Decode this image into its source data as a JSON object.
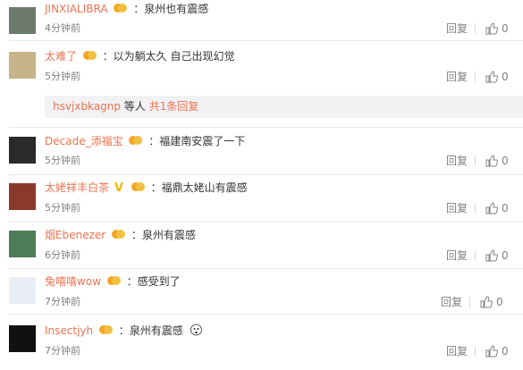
{
  "comments": [
    {
      "user": "JINXIALIBRA",
      "text": "：泉州也有震感",
      "time": "4分钟前",
      "reply": "回复",
      "likes": "0",
      "avatar_color": "#6b7a6a"
    },
    {
      "user": "太难了",
      "text": "：以为躺太久 自己出现幻觉",
      "time": "5分钟前",
      "reply": "回复",
      "likes": "0",
      "avatar_color": "#c8b48a",
      "subreply": {
        "user": "hsvjxbkagnp",
        "mid": " 等人 ",
        "link": "共1条回复"
      }
    },
    {
      "user": "Decade_添福宝",
      "text": "：福建南安震了一下",
      "time": "5分钟前",
      "reply": "回复",
      "likes": "0",
      "avatar_color": "#2a2a2a"
    },
    {
      "user": "太姥祥丰白茶",
      "badge": "V",
      "text": "：福鼎太姥山有震感",
      "time": "5分钟前",
      "reply": "回复",
      "likes": "0",
      "avatar_color": "#8a3a2a"
    },
    {
      "user": "烟Ebenezer",
      "text": "：泉州有震感",
      "time": "6分钟前",
      "reply": "回复",
      "likes": "0",
      "avatar_color": "#4f7d5a"
    },
    {
      "user": "兔嘻嘻wow",
      "text": "：感受到了",
      "time": "7分钟前",
      "reply": "回复",
      "likes": "0",
      "avatar_color": "#e8eef4"
    },
    {
      "user": "Insectjyh",
      "text": "：泉州有震感",
      "time": "7分钟前",
      "reply": "回复",
      "likes": "0",
      "avatar_color": "#111111"
    }
  ]
}
